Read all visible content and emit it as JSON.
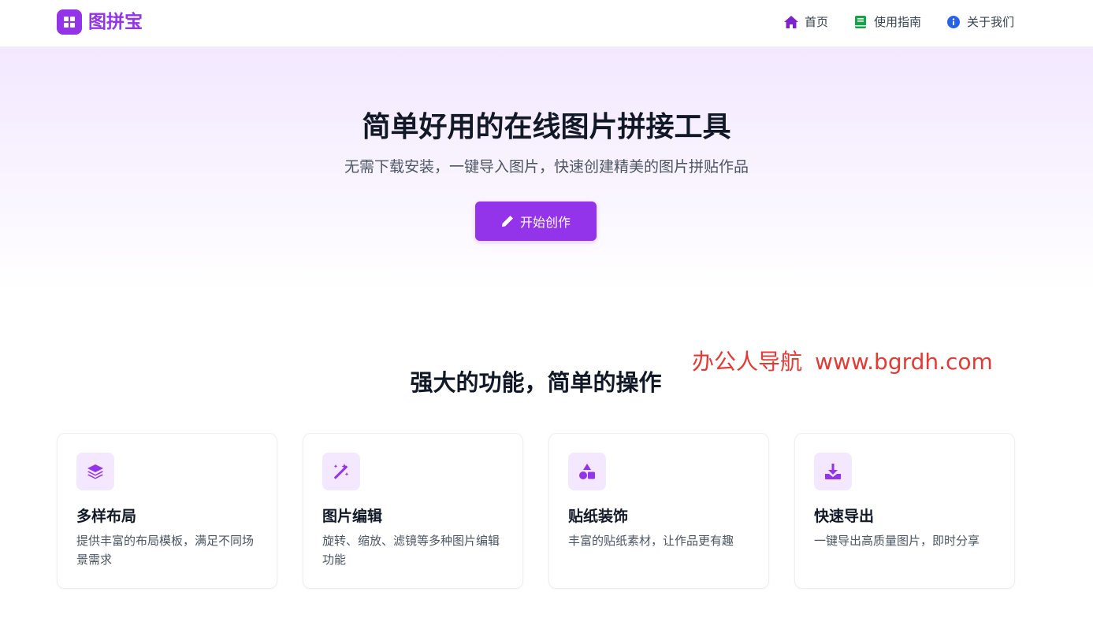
{
  "header": {
    "logo_text": "图拼宝",
    "nav": [
      {
        "label": "首页",
        "icon": "home-icon",
        "color": "#7e22ce"
      },
      {
        "label": "使用指南",
        "icon": "book-icon",
        "color": "#16a34a"
      },
      {
        "label": "关于我们",
        "icon": "info-icon",
        "color": "#2563eb"
      }
    ]
  },
  "hero": {
    "title": "简单好用的在线图片拼接工具",
    "subtitle": "无需下载安装，一键导入图片，快速创建精美的图片拼贴作品",
    "cta_label": "开始创作"
  },
  "watermark": {
    "text": "办公人导航",
    "url": "www.bgrdh.com"
  },
  "features": {
    "title": "强大的功能，简单的操作",
    "cards": [
      {
        "icon": "layers-icon",
        "title": "多样布局",
        "desc": "提供丰富的布局模板，满足不同场景需求"
      },
      {
        "icon": "magic-wand-icon",
        "title": "图片编辑",
        "desc": "旋转、缩放、滤镜等多种图片编辑功能"
      },
      {
        "icon": "shapes-icon",
        "title": "贴纸装饰",
        "desc": "丰富的贴纸素材，让作品更有趣"
      },
      {
        "icon": "download-icon",
        "title": "快速导出",
        "desc": "一键导出高质量图片，即时分享"
      }
    ]
  },
  "colors": {
    "accent": "#9333ea",
    "accent_light": "#f3e8ff",
    "watermark": "#e53935"
  }
}
